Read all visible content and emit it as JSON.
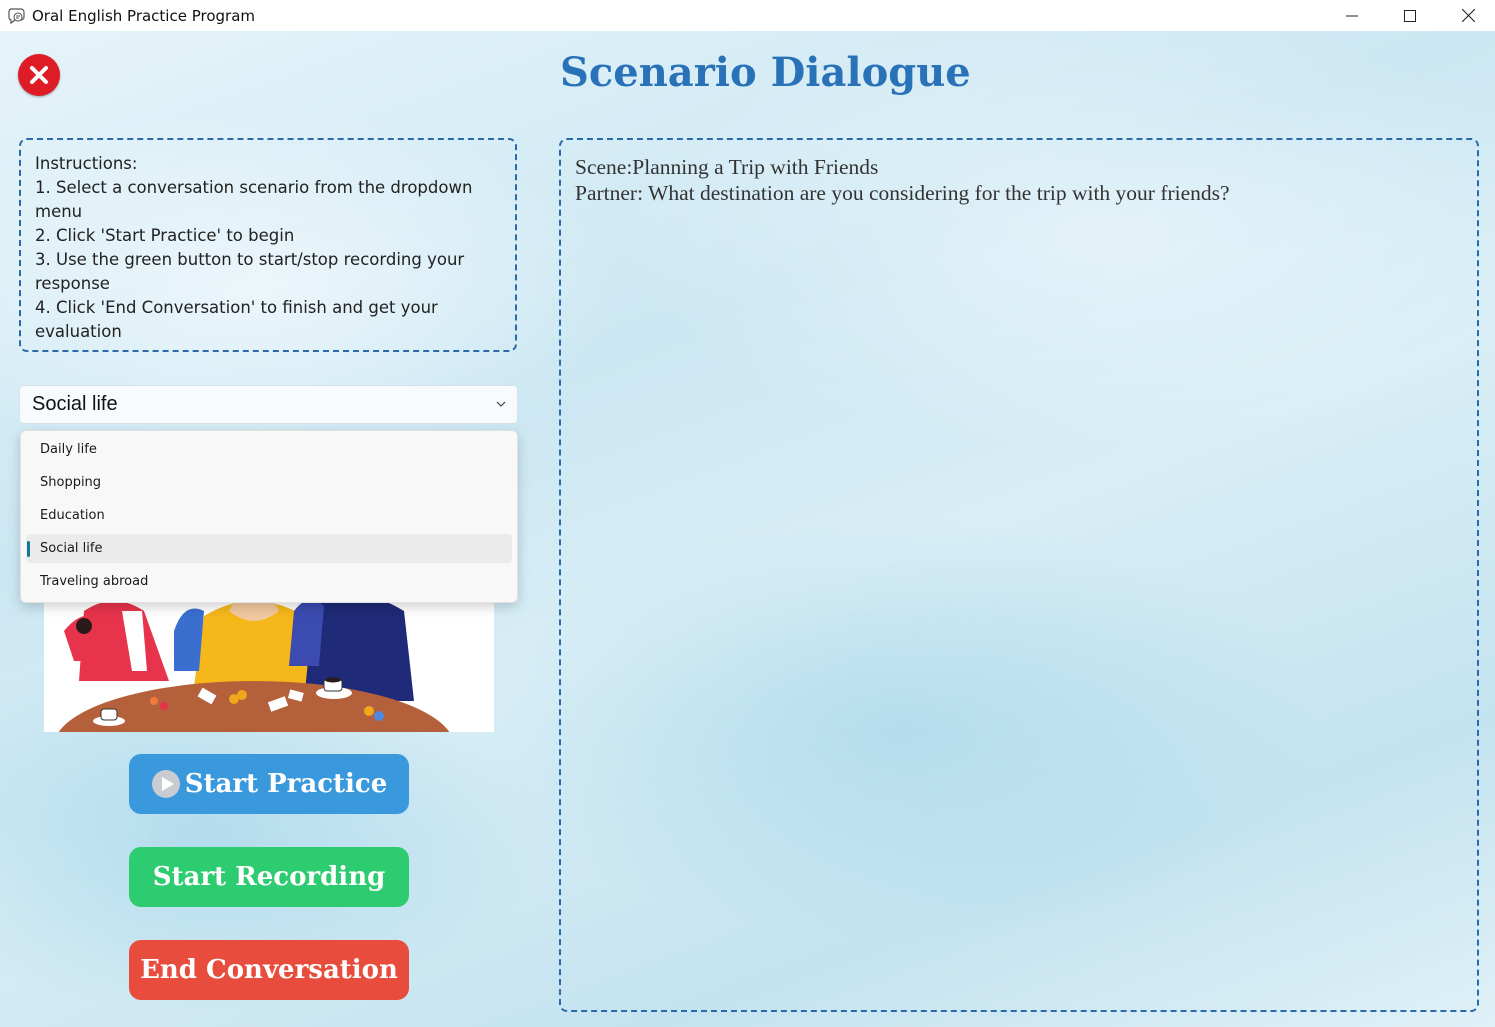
{
  "window": {
    "title": "Oral English Practice Program",
    "icons": {
      "app": "chat-bubble-icon",
      "minimize": "minimize-icon",
      "maximize": "maximize-icon",
      "close": "close-icon"
    }
  },
  "header": {
    "title": "Scenario Dialogue",
    "close_icon": "close-circle-icon",
    "close_color": "#dd1c26"
  },
  "instructions": {
    "heading": "Instructions:",
    "lines": [
      "1. Select a conversation scenario from the dropdown menu",
      "2. Click 'Start Practice' to begin",
      "3. Use the green button to start/stop recording your response",
      "4. Click 'End Conversation' to finish and get your evaluation"
    ]
  },
  "scenario_select": {
    "selected": "Social life",
    "options": [
      "Daily life",
      "Shopping",
      "Education",
      "Social life",
      "Traveling abroad"
    ],
    "selected_index": 3
  },
  "buttons": {
    "start_practice": "Start Practice",
    "start_recording": "Start Recording",
    "end_conversation": "End Conversation",
    "start_practice_icon": "play-icon"
  },
  "colors": {
    "title": "#2a72b8",
    "start_practice": "#3a98dc",
    "start_recording": "#2ecc71",
    "end_conversation": "#e74c3c",
    "dashed_border": "#2b6aa8"
  },
  "dialogue": {
    "scene": "Scene:Planning a Trip with Friends",
    "partner": "Partner: What destination are you considering for the trip with your friends?"
  }
}
